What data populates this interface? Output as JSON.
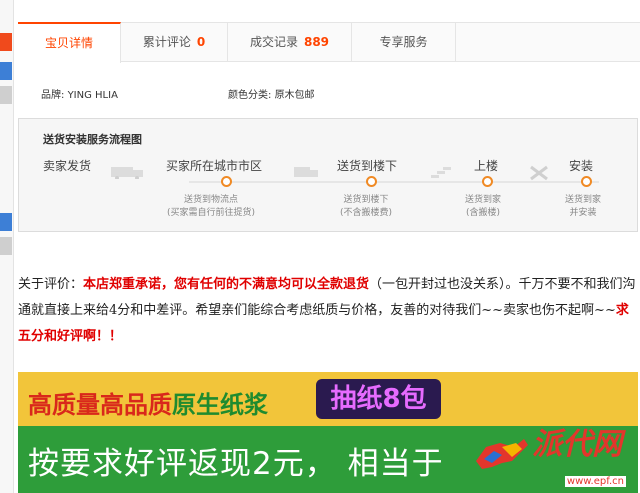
{
  "tabs": [
    {
      "label": "宝贝详情",
      "count": ""
    },
    {
      "label": "累计评论",
      "count": "0"
    },
    {
      "label": "成交记录",
      "count": "889"
    },
    {
      "label": "专享服务",
      "count": ""
    }
  ],
  "attrs": {
    "brand_label": "品牌:",
    "brand_value": "YING HLIA",
    "color_label": "颜色分类:",
    "color_value": "原木包邮"
  },
  "flow": {
    "title": "送货安装服务流程图",
    "steps": [
      "卖家发货",
      "买家所在城市市区",
      "送货到楼下",
      "上楼",
      "安装"
    ],
    "subs": [
      "送货到物流点\n(买家需自行前往提货)",
      "送货到楼下\n(不含搬楼费)",
      "送货到家\n(含搬楼)",
      "送货到家\n并安装"
    ]
  },
  "notice": {
    "prefix": "关于评价：",
    "red1": "本店郑重承诺，您有任何的不满意均可以全款退货",
    "mid1": "（一包开封过也没关系）。千万不要不和我们沟通就直接上来给4分和中差评。希望亲们能综合考虑纸质与价格，友善的对待我们~~卖家也伤不起啊~~",
    "red2": "求五分和好评啊！！"
  },
  "banner": {
    "line1_red": "高质量高品质",
    "line1_green": "原生纸浆",
    "pill": "抽纸8包",
    "line2": "按要求好评返现2元， 相当于"
  },
  "watermark": {
    "text": "派代网",
    "url": "www.epf.cn"
  },
  "colors": {
    "accent": "#ff4400",
    "flow_dot": "#f08a24",
    "banner_yellow": "#f2c53a",
    "banner_green": "#2e9d3a"
  }
}
